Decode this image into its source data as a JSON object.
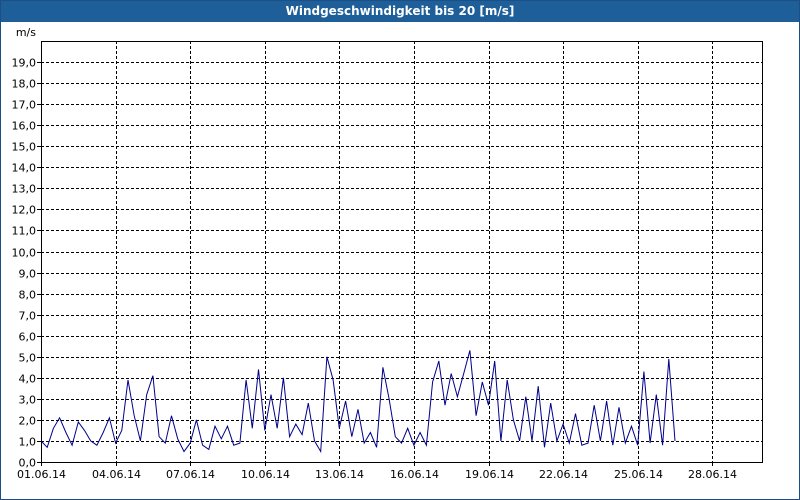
{
  "window": {
    "title": "Windgeschwindigkeit bis 20 [m/s]"
  },
  "colors": {
    "title_bar": "#1e5f9a",
    "line": "#00008b",
    "grid": "#000000"
  },
  "chart_data": {
    "type": "line",
    "title": "Windgeschwindigkeit bis 20 [m/s]",
    "ylabel": "m/s",
    "xlabel": "",
    "ylim": [
      0,
      20
    ],
    "xlim": [
      "01.06.14",
      "30.06.14"
    ],
    "grid": true,
    "x_ticks": [
      "01.06.14",
      "04.06.14",
      "07.06.14",
      "10.06.14",
      "13.06.14",
      "16.06.14",
      "19.06.14",
      "22.06.14",
      "25.06.14",
      "28.06.14"
    ],
    "y_ticks": [
      "0,0",
      "1,0",
      "2,0",
      "3,0",
      "4,0",
      "5,0",
      "6,0",
      "7,0",
      "8,0",
      "9,0",
      "10,0",
      "11,0",
      "12,0",
      "13,0",
      "14,0",
      "15,0",
      "16,0",
      "17,0",
      "18,0",
      "19,0"
    ],
    "series": [
      {
        "points": [
          [
            "01.06.14",
            1.0
          ],
          [
            "01.06.14 06:00",
            0.7
          ],
          [
            "01.06.14 12:00",
            1.6
          ],
          [
            "01.06.14 18:00",
            2.1
          ],
          [
            "02.06.14",
            1.4
          ],
          [
            "02.06.14 06:00",
            0.8
          ],
          [
            "02.06.14 12:00",
            1.9
          ],
          [
            "02.06.14 18:00",
            1.5
          ],
          [
            "03.06.14",
            1.0
          ],
          [
            "03.06.14 06:00",
            0.8
          ],
          [
            "03.06.14 12:00",
            1.4
          ],
          [
            "03.06.14 18:00",
            2.1
          ],
          [
            "04.06.14",
            0.9
          ],
          [
            "04.06.14 06:00",
            1.5
          ],
          [
            "04.06.14 12:00",
            3.9
          ],
          [
            "04.06.14 18:00",
            2.2
          ],
          [
            "05.06.14",
            1.0
          ],
          [
            "05.06.14 06:00",
            3.2
          ],
          [
            "05.06.14 12:00",
            4.1
          ],
          [
            "05.06.14 18:00",
            1.2
          ],
          [
            "06.06.14",
            0.9
          ],
          [
            "06.06.14 06:00",
            2.2
          ],
          [
            "06.06.14 12:00",
            1.1
          ],
          [
            "06.06.14 18:00",
            0.5
          ],
          [
            "07.06.14",
            0.9
          ],
          [
            "07.06.14 06:00",
            2.0
          ],
          [
            "07.06.14 12:00",
            0.8
          ],
          [
            "07.06.14 18:00",
            0.6
          ],
          [
            "08.06.14",
            1.7
          ],
          [
            "08.06.14 06:00",
            1.1
          ],
          [
            "08.06.14 12:00",
            1.7
          ],
          [
            "08.06.14 18:00",
            0.8
          ],
          [
            "09.06.14",
            0.9
          ],
          [
            "09.06.14 06:00",
            3.9
          ],
          [
            "09.06.14 12:00",
            1.6
          ],
          [
            "09.06.14 18:00",
            4.4
          ],
          [
            "10.06.14",
            1.5
          ],
          [
            "10.06.14 06:00",
            3.2
          ],
          [
            "10.06.14 12:00",
            1.6
          ],
          [
            "10.06.14 18:00",
            4.0
          ],
          [
            "11.06.14",
            1.2
          ],
          [
            "11.06.14 06:00",
            1.8
          ],
          [
            "11.06.14 12:00",
            1.3
          ],
          [
            "11.06.14 18:00",
            2.8
          ],
          [
            "12.06.14",
            1.0
          ],
          [
            "12.06.14 06:00",
            0.5
          ],
          [
            "12.06.14 12:00",
            5.0
          ],
          [
            "12.06.14 18:00",
            3.9
          ],
          [
            "13.06.14",
            1.6
          ],
          [
            "13.06.14 06:00",
            2.9
          ],
          [
            "13.06.14 12:00",
            1.2
          ],
          [
            "13.06.14 18:00",
            2.5
          ],
          [
            "14.06.14",
            0.9
          ],
          [
            "14.06.14 06:00",
            1.4
          ],
          [
            "14.06.14 12:00",
            0.7
          ],
          [
            "14.06.14 18:00",
            4.5
          ],
          [
            "15.06.14",
            3.0
          ],
          [
            "15.06.14 06:00",
            1.2
          ],
          [
            "15.06.14 12:00",
            0.9
          ],
          [
            "15.06.14 18:00",
            1.6
          ],
          [
            "16.06.14",
            0.8
          ],
          [
            "16.06.14 06:00",
            1.4
          ],
          [
            "16.06.14 12:00",
            0.8
          ],
          [
            "16.06.14 18:00",
            3.8
          ],
          [
            "17.06.14",
            4.8
          ],
          [
            "17.06.14 06:00",
            2.7
          ],
          [
            "17.06.14 12:00",
            4.2
          ],
          [
            "17.06.14 18:00",
            3.1
          ],
          [
            "18.06.14",
            4.2
          ],
          [
            "18.06.14 06:00",
            5.3
          ],
          [
            "18.06.14 12:00",
            2.2
          ],
          [
            "18.06.14 18:00",
            3.8
          ],
          [
            "19.06.14",
            2.7
          ],
          [
            "19.06.14 06:00",
            4.8
          ],
          [
            "19.06.14 12:00",
            1.0
          ],
          [
            "19.06.14 18:00",
            3.9
          ],
          [
            "20.06.14",
            2.0
          ],
          [
            "20.06.14 06:00",
            1.0
          ],
          [
            "20.06.14 12:00",
            3.1
          ],
          [
            "20.06.14 18:00",
            1.0
          ],
          [
            "21.06.14",
            3.6
          ],
          [
            "21.06.14 06:00",
            0.7
          ],
          [
            "21.06.14 12:00",
            2.8
          ],
          [
            "21.06.14 18:00",
            1.0
          ],
          [
            "22.06.14",
            1.8
          ],
          [
            "22.06.14 06:00",
            0.9
          ],
          [
            "22.06.14 12:00",
            2.3
          ],
          [
            "22.06.14 18:00",
            0.8
          ],
          [
            "23.06.14",
            0.9
          ],
          [
            "23.06.14 06:00",
            2.7
          ],
          [
            "23.06.14 12:00",
            1.0
          ],
          [
            "23.06.14 18:00",
            2.9
          ],
          [
            "24.06.14",
            0.8
          ],
          [
            "24.06.14 06:00",
            2.6
          ],
          [
            "24.06.14 12:00",
            0.9
          ],
          [
            "24.06.14 18:00",
            1.7
          ],
          [
            "25.06.14",
            0.8
          ],
          [
            "25.06.14 06:00",
            4.3
          ],
          [
            "25.06.14 12:00",
            0.9
          ],
          [
            "25.06.14 18:00",
            3.2
          ],
          [
            "26.06.14",
            0.8
          ],
          [
            "26.06.14 06:00",
            4.9
          ],
          [
            "26.06.14 12:00",
            1.0
          ]
        ]
      }
    ]
  }
}
